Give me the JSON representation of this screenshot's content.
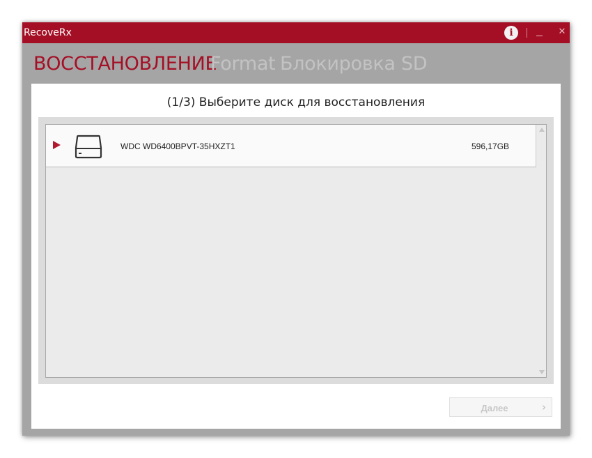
{
  "window": {
    "title": "RecoveRx"
  },
  "titlebar": {
    "info_glyph": "i",
    "close_glyph": "✕"
  },
  "tabs": [
    {
      "label": "ВОССТАНОВЛЕНИЕ",
      "active": true
    },
    {
      "label": "Format",
      "active": false
    },
    {
      "label": "Блокировка SD",
      "active": false
    }
  ],
  "step": {
    "title": "(1/3) Выберите диск для восстановления"
  },
  "disks": [
    {
      "name": "WDC WD6400BPVT-35HXZT1",
      "size": "596,17GB",
      "icon": "hard-drive-icon"
    }
  ],
  "footer": {
    "next_label": "Далее",
    "next_glyph": "›"
  },
  "colors": {
    "accent": "#a50f25",
    "frame": "#a5a5a5",
    "inactive_tab": "#c3c3c3"
  }
}
